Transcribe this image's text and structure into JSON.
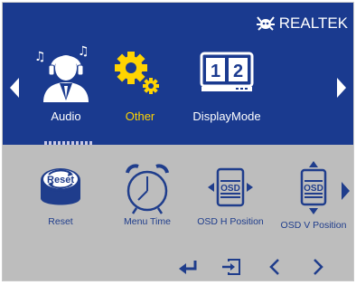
{
  "brand": {
    "name": "REALTEK",
    "logo_icon": "realtek-crab-logo"
  },
  "menu_items": [
    {
      "label": "Audio",
      "icon": "headset-user-icon"
    },
    {
      "label": "Other",
      "icon": "gear-icon",
      "active": true
    },
    {
      "label": "DisplayMode",
      "icon": "dual-display-icon"
    }
  ],
  "sub_items": [
    {
      "label": "Reset",
      "icon": "reset-button-icon"
    },
    {
      "label": "Menu Time",
      "icon": "alarm-clock-icon"
    },
    {
      "label": "OSD H Position",
      "icon": "osd-horizontal-icon"
    },
    {
      "label": "OSD V Position",
      "icon": "osd-vertical-icon"
    }
  ],
  "nav_controls": [
    "enter-icon",
    "exit-icon",
    "prev-icon",
    "next-icon"
  ],
  "colors": {
    "top_bg": "#1a3a8f",
    "bottom_bg": "#bdbdbd",
    "active": "#ffd400",
    "label_blue": "#1f3d8c"
  }
}
